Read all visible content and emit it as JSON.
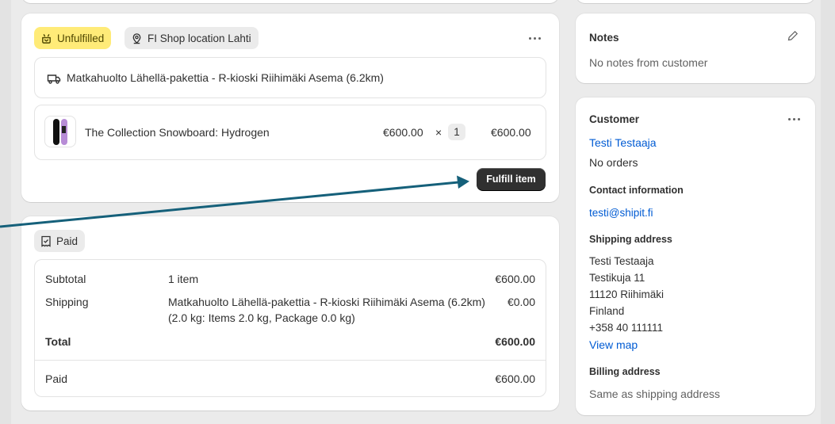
{
  "fulfillment": {
    "status_badge": "Unfulfilled",
    "location_badge": "FI Shop location Lahti",
    "shipping_method": "Matkahuolto Lähellä-pakettia - R-kioski Riihimäki Asema (6.2km)",
    "item": {
      "name": "The Collection Snowboard: Hydrogen",
      "unit_price": "€600.00",
      "times": "×",
      "quantity": "1",
      "total": "€600.00"
    },
    "action_button": "Fulfill item"
  },
  "payment": {
    "status_badge": "Paid",
    "rows": {
      "subtotal_label": "Subtotal",
      "subtotal_desc": "1 item",
      "subtotal_amount": "€600.00",
      "shipping_label": "Shipping",
      "shipping_desc": "Matkahuolto Lähellä-pakettia - R-kioski Riihimäki Asema (6.2km)",
      "shipping_desc2": "(2.0 kg: Items 2.0 kg, Package 0.0 kg)",
      "shipping_amount": "€0.00",
      "total_label": "Total",
      "total_amount": "€600.00",
      "paid_label": "Paid",
      "paid_amount": "€600.00"
    }
  },
  "notes": {
    "title": "Notes",
    "text": "No notes from customer"
  },
  "customer": {
    "title": "Customer",
    "name": "Testi Testaaja",
    "orders": "No orders",
    "contact_heading": "Contact information",
    "email": "testi@shipit.fi",
    "shipping_heading": "Shipping address",
    "address": [
      "Testi Testaaja",
      "Testikuja 11",
      "11120 Riihimäki",
      "Finland",
      "+358 40 111111"
    ],
    "view_map": "View map",
    "billing_heading": "Billing address",
    "billing_text": "Same as shipping address"
  },
  "colors": {
    "unfulfilled_badge": "#ffeb78",
    "annotation_arrow": "#15607a",
    "link": "#005bd3"
  },
  "icons": [
    "unfulfilled-icon",
    "location-pin-icon",
    "truck-icon",
    "receipt-icon",
    "pencil-icon",
    "more-horizontal-icon"
  ]
}
